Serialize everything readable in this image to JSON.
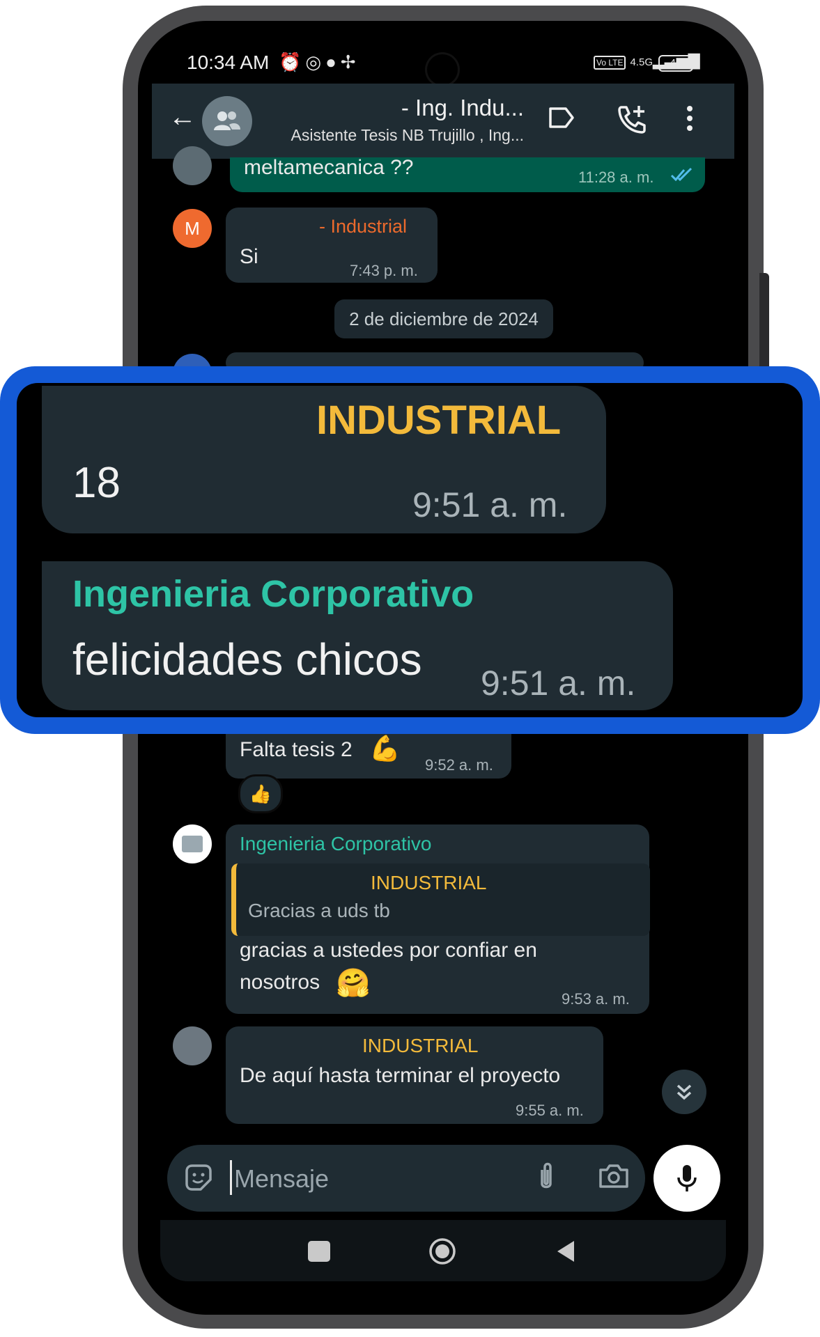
{
  "status_bar": {
    "time": "10:34 AM",
    "network": "4.5G",
    "battery": "48",
    "volte": "Vo LTE"
  },
  "header": {
    "title": "- Ing. Indu...",
    "subtitle": "Asistente Tesis NB Trujillo , Ing..."
  },
  "messages": {
    "m1": {
      "text": "meltamecanica ??",
      "time": "11:28 a. m."
    },
    "m2": {
      "avatar_initial": "M",
      "sender": "- Industrial",
      "text": "Si",
      "time": "7:43 p. m."
    },
    "date_separator": "2 de diciembre de 2024",
    "m3": {
      "sender": "INDUSTRIAL",
      "text": "18",
      "time": "9:51 a. m."
    },
    "m4": {
      "sender": "Ingenieria Corporativo",
      "text": "felicidades chicos",
      "time": "9:51 a. m."
    },
    "m5": {
      "text": "Falta tesis 2",
      "emoji": "💪",
      "time": "9:52 a. m.",
      "reaction": "👍"
    },
    "m6": {
      "sender": "Ingenieria Corporativo",
      "quote_sender": "INDUSTRIAL",
      "quote_text": "Gracias a uds tb",
      "text_line1": "gracias a ustedes por confiar en",
      "text_line2": "nosotros",
      "emoji": "🤗",
      "time": "9:53 a. m."
    },
    "m7": {
      "sender": "INDUSTRIAL",
      "text": "De aquí hasta terminar el proyecto",
      "time": "9:55 a. m."
    }
  },
  "input": {
    "placeholder": "Mensaje"
  },
  "colors": {
    "accent_highlight": "#145ad6",
    "bubble_incoming": "#202c33",
    "bubble_outgoing": "#005c4b",
    "sender_industrial": "#f3ba3b",
    "sender_corporativo": "#2ec4a6",
    "sender_m": "#ec6a2c"
  }
}
